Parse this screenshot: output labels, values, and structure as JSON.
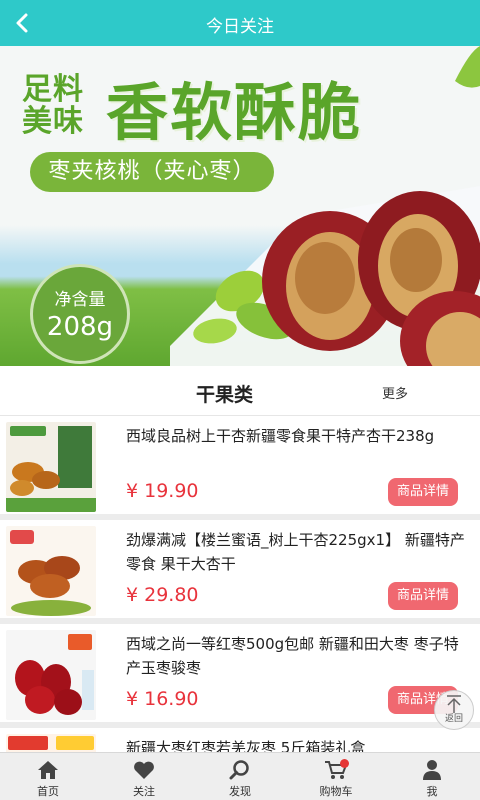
{
  "header": {
    "title": "今日关注"
  },
  "banner": {
    "slogan_small": "足料\n美味",
    "slogan_small_line1": "足料",
    "slogan_small_line2": "美味",
    "slogan_big": "香软酥脆",
    "pill_text": "枣夹核桃（夹心枣）",
    "badge_line1": "净含量",
    "badge_line2": "208g"
  },
  "section": {
    "title": "干果类",
    "more": "更多"
  },
  "products": [
    {
      "title": "西域良品树上干杏新疆零食果干特产杏干238g",
      "price": "¥ 19.90",
      "button": "商品详情"
    },
    {
      "title": "劲爆满减【楼兰蜜语_树上干杏225gx1】 新疆特产零食 果干大杏干",
      "price": "¥ 29.80",
      "button": "商品详情"
    },
    {
      "title": "西域之尚一等红枣500g包邮 新疆和田大枣 枣子特产玉枣骏枣",
      "price": "¥ 16.90",
      "button": "商品详情"
    },
    {
      "title": "新疆大枣红枣若羌灰枣 5斤箱装礼盒",
      "price": "",
      "button": ""
    }
  ],
  "back_to_top": {
    "label": "返回"
  },
  "bottom_nav": [
    {
      "label": "首页",
      "icon": "home-icon"
    },
    {
      "label": "关注",
      "icon": "heart-icon"
    },
    {
      "label": "发现",
      "icon": "search-icon"
    },
    {
      "label": "购物车",
      "icon": "cart-icon"
    },
    {
      "label": "我",
      "icon": "person-icon"
    }
  ],
  "colors": {
    "topbar": "#2ec9c9",
    "accent_green": "#5aa52a",
    "price_red": "#e8333c",
    "button_pink": "#f06870"
  }
}
